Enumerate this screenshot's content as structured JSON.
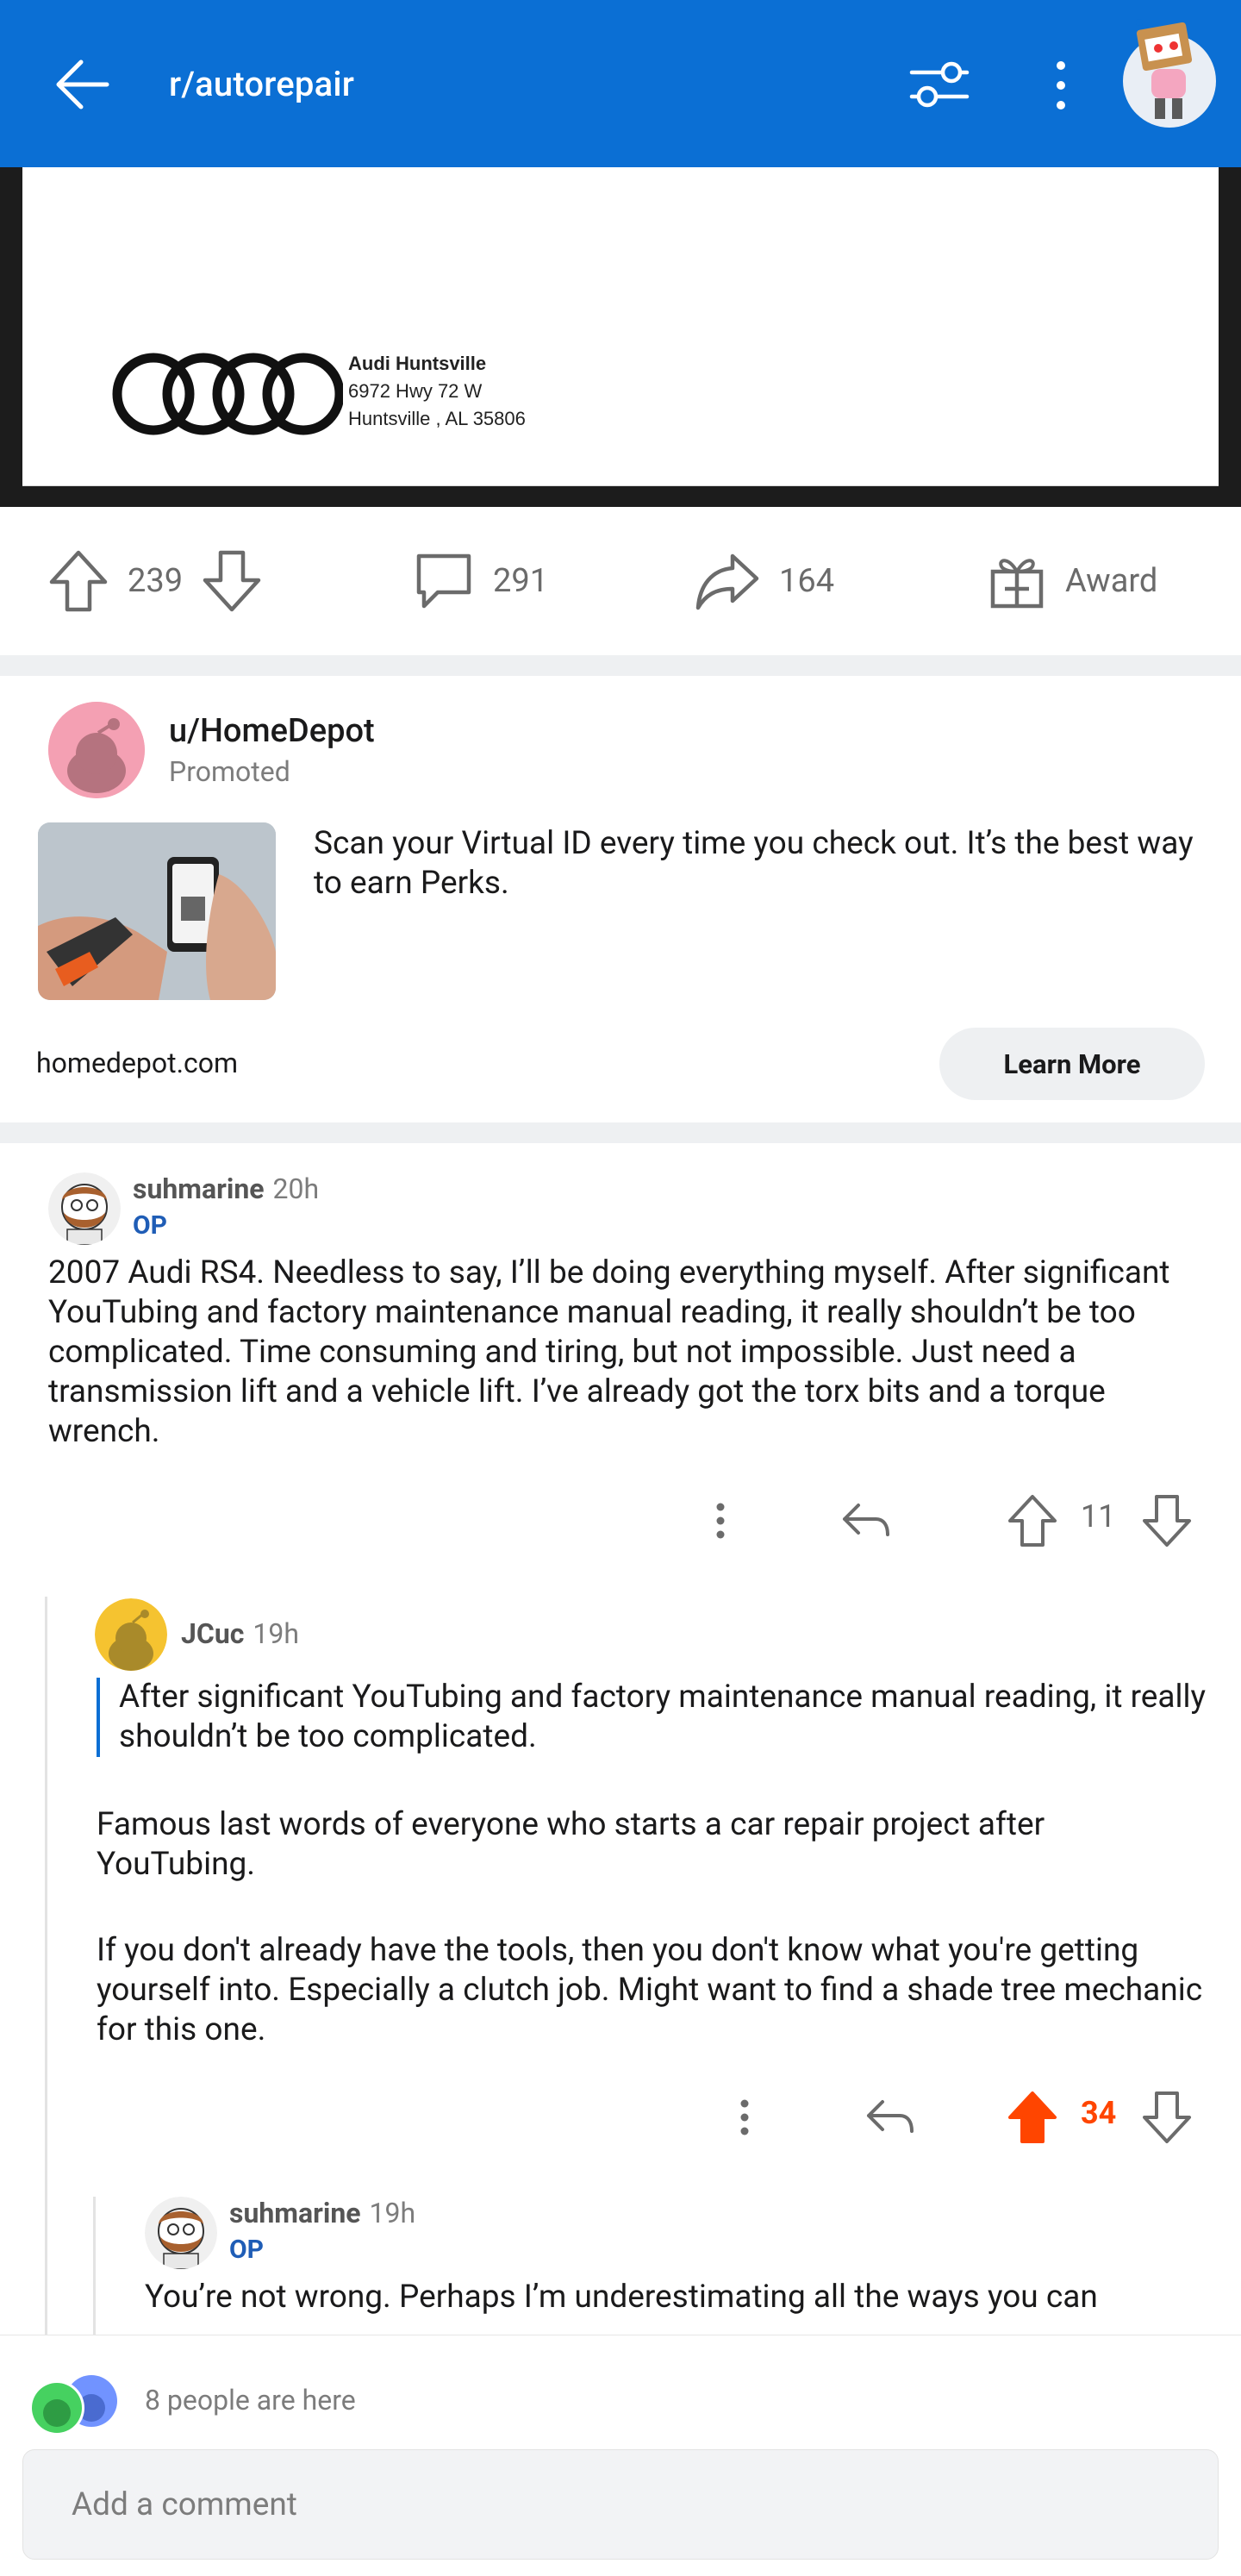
{
  "header": {
    "title": "r/autorepair",
    "bg_color": "#0b6fd4"
  },
  "ad_image": {
    "dealer_name": "Audi Huntsville",
    "dealer_address_1": "6972 Hwy 72 W",
    "dealer_address_2": "Huntsville , AL 35806"
  },
  "post_actions": {
    "upvotes": "239",
    "comments": "291",
    "shares": "164",
    "award_label": "Award"
  },
  "promoted": {
    "username": "u/HomeDepot",
    "label": "Promoted",
    "text": "Scan your Virtual ID every time you check out. It’s the best way to earn Perks.",
    "domain": "homedepot.com",
    "cta": "Learn More"
  },
  "comments": [
    {
      "user": "suhmarine",
      "time": "20h",
      "op_badge": "OP",
      "body": "2007 Audi RS4. Needless to say, I’ll be doing everything myself. After significant YouTubing and factory maintenance manual reading, it really shouldn’t be too complicated. Time consuming and tiring, but not impossible. Just need a transmission lift and a vehicle lift. I’ve already got the torx bits and a torque wrench.",
      "score": "11",
      "upvoted": false
    },
    {
      "user": "JCuc",
      "time": "19h",
      "quote": "After significant YouTubing and factory maintenance manual reading, it really shouldn’t be too complicated.",
      "body_p1": "Famous last words of everyone who starts a car repair project after YouTubing.",
      "body_p2": "If you don't already have the tools, then you don't know what you're getting yourself into.  Especially a clutch job.  Might want to find a shade tree mechanic for this one.",
      "score": "34",
      "upvoted": true
    },
    {
      "user": "suhmarine",
      "time": "19h",
      "op_badge": "OP",
      "body": "You’re not wrong. Perhaps I’m underestimating all the ways you can"
    }
  ],
  "bottom": {
    "presence_text": "8 people are here",
    "comment_placeholder": "Add a comment"
  },
  "colors": {
    "upvote_active": "#ff4500",
    "op_badge": "#1f5db6",
    "quote_bar": "#0b6fd4"
  }
}
